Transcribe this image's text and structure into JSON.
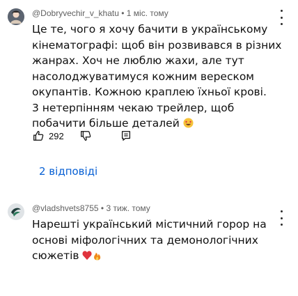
{
  "comments": [
    {
      "author": "@Dobryvechir_v_khatu",
      "separator": "•",
      "time": "1 міс. тому",
      "text": "Це те, чого я хочу бачити в українському кінематографі: щоб він розвивався в різних жанрах. Хоч не люблю жахи, але тут насолоджуватимуся кожним вереском окупантів. Кожною краплею їхньої крові.\n3 нетерпінням чекаю трейлер, щоб побачити більше деталей",
      "emoji": "😍",
      "likes": "292",
      "replies_label": "2 відповіді"
    },
    {
      "author": "@vladshvets8755",
      "separator": "•",
      "time": "3 тиж. тому",
      "text": "Нарешті український містичний горор на основі міфологічних та демонологічних сюжетів",
      "emoji": "❤️🔥"
    }
  ],
  "colors": {
    "link": "#065fd4",
    "meta": "#606060",
    "text": "#0f0f0f"
  },
  "icons": [
    "avatar-icon",
    "more-vert-icon",
    "thumb-up-icon",
    "thumb-down-icon",
    "reply-icon"
  ]
}
